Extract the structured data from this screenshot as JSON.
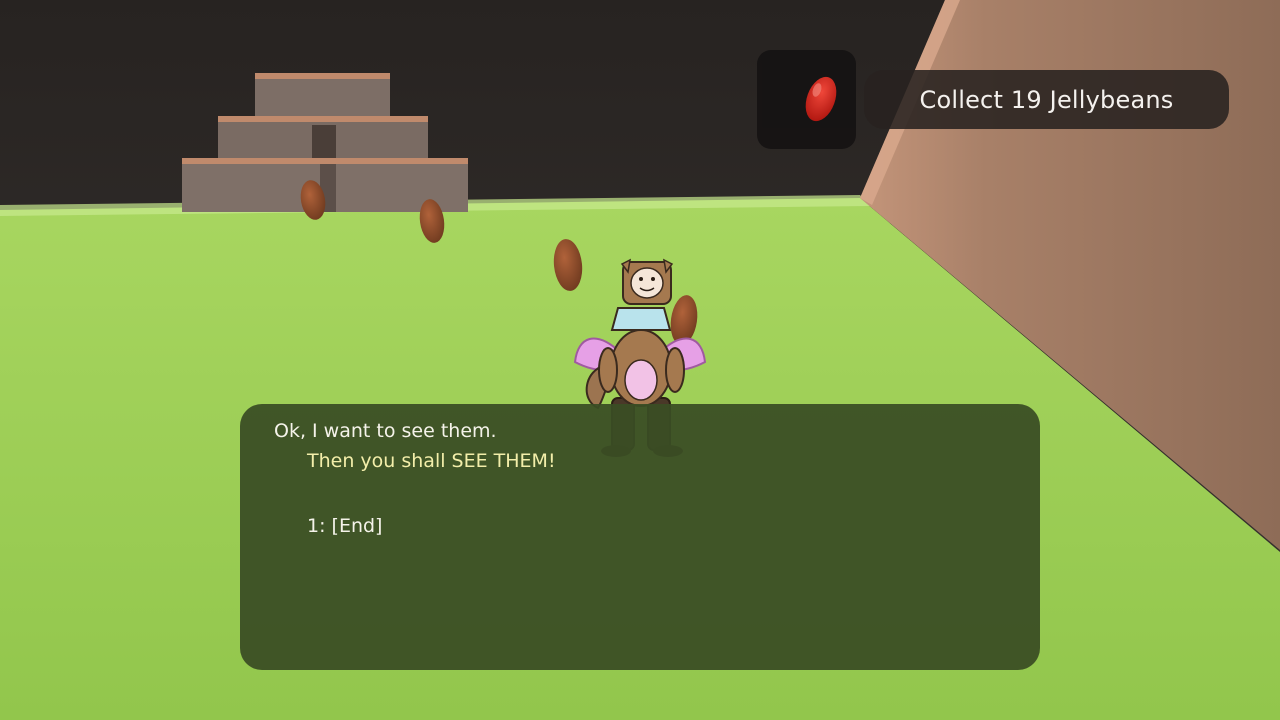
{
  "hud": {
    "objective": {
      "text": "Collect 19 Jellybeans",
      "icon": "jellybean-icon",
      "icon_color": "#e0261b"
    }
  },
  "dialog": {
    "prompt": "Ok, I want to see them.",
    "response": "Then you shall SEE THEM!",
    "choices": [
      {
        "label": "1: [End]"
      }
    ]
  },
  "colors": {
    "ground": "#9dce55",
    "wall": "#a47e66",
    "sky": "#2f2b29",
    "dialog_bg": "#3a4e24",
    "response_text": "#f3eeaa",
    "jellybean_world": "#8a4726"
  }
}
